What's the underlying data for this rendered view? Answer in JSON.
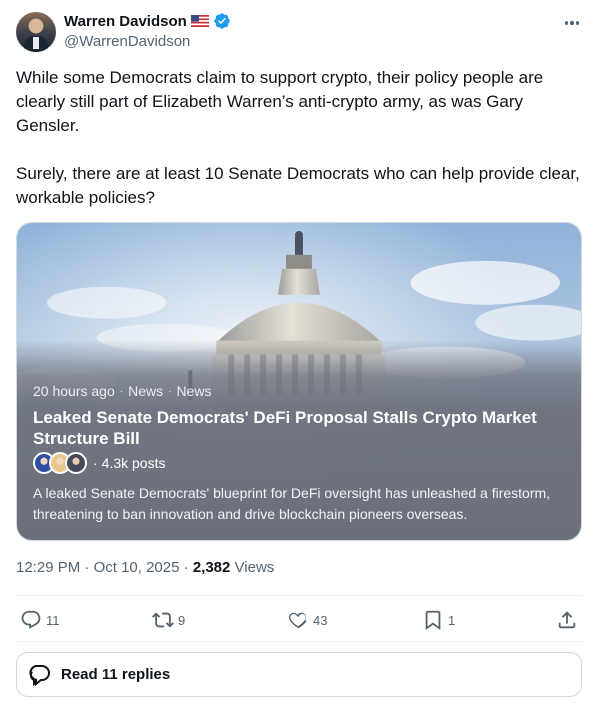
{
  "author": {
    "name": "Warren Davidson",
    "handle": "@WarrenDavidson"
  },
  "tweet": {
    "paragraph1": "While some Democrats claim to support crypto, their policy people are clearly still part of Elizabeth Warren’s anti-crypto army, as was Gary Gensler.",
    "paragraph2": "Surely, there are at least 10 Senate Democrats who can help provide clear, workable policies?"
  },
  "card": {
    "time": "20 hours ago",
    "category1": "News",
    "category2": "News",
    "separator": "·",
    "title": "Leaked Senate Democrats' DeFi Proposal Stalls Crypto Market Structure Bill",
    "posts_count": "4.3k posts",
    "posts_prefix": "·",
    "description": "A leaked Senate Democrats' blueprint for DeFi oversight has unleashed a firestorm, threatening to ban innovation and drive blockchain pioneers overseas."
  },
  "meta": {
    "time": "12:29 PM",
    "date": "Oct 10, 2025",
    "views_count": "2,382",
    "views_label": "Views",
    "sep": "·"
  },
  "actions": {
    "replies": "11",
    "reposts": "9",
    "likes": "43",
    "bookmarks": "1"
  },
  "read_replies": {
    "label": "Read 11 replies"
  },
  "colors": {
    "verified": "#1d9bf0",
    "secondary_text": "#536471",
    "primary_text": "#0f1419",
    "border": "#cfd9de"
  },
  "icons": {
    "more": "more-icon",
    "verified": "verified-icon",
    "flag": "us-flag-icon",
    "reply": "reply-icon",
    "repost": "repost-icon",
    "like": "like-icon",
    "bookmark": "bookmark-icon",
    "share": "share-icon",
    "replies": "speech-bubbles-icon"
  }
}
